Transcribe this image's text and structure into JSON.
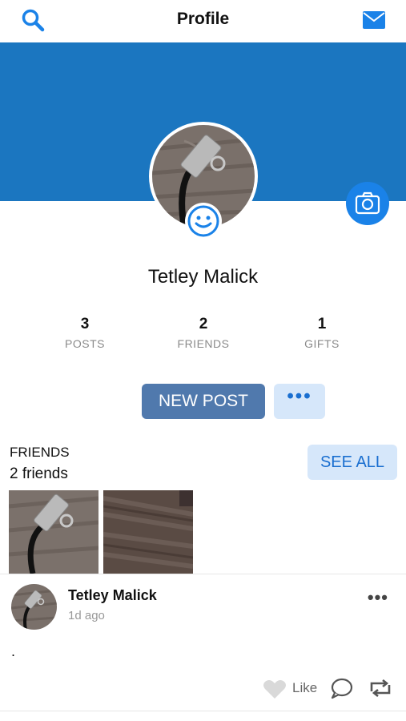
{
  "header": {
    "title": "Profile",
    "left_icon": "search-icon",
    "right_icon": "mail-icon"
  },
  "colors": {
    "cover": "#1b76c0",
    "accent": "#1a82e8",
    "primary_button": "#5079ad",
    "light_button": "#d6e7fa"
  },
  "profile": {
    "name": "Tetley Malick"
  },
  "stats": [
    {
      "value": "3",
      "label": "POSTS"
    },
    {
      "value": "2",
      "label": "FRIENDS"
    },
    {
      "value": "1",
      "label": "GIFTS"
    }
  ],
  "actions": {
    "new_post": "NEW POST",
    "more": "•••"
  },
  "friends": {
    "heading": "FRIENDS",
    "count_text": "2 friends",
    "see_all": "SEE ALL"
  },
  "post": {
    "author": "Tetley Malick",
    "time": "1d ago",
    "body": ".",
    "more": "•••",
    "like_label": "Like"
  }
}
